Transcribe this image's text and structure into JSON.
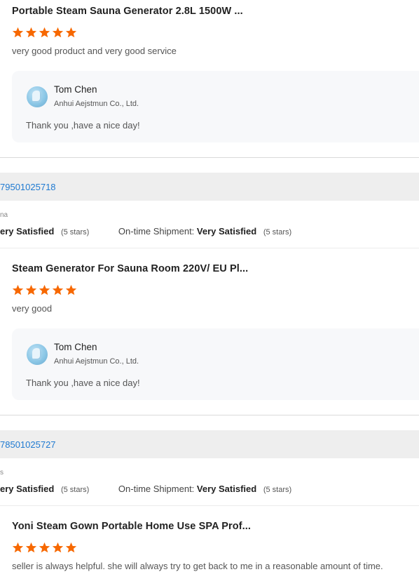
{
  "colors": {
    "star": "#f76800",
    "order_link": "#1f7ad1"
  },
  "reviews": [
    {
      "product_title": "Portable Steam Sauna Generator 2.8L 1500W ...",
      "rating": 5,
      "text": "very good product and very good service",
      "reply": {
        "name": "Tom Chen",
        "company": "Anhui Aejstmun Co., Ltd.",
        "text": "Thank you ,have a nice day!"
      }
    },
    {
      "order_id": "79501025718",
      "country": "na",
      "supplier_service_value": "ery Satisfied",
      "supplier_service_stars": "(5 stars)",
      "shipment_label": "On-time Shipment:",
      "shipment_value": "Very Satisfied",
      "shipment_stars": "(5 stars)",
      "product_title": "Steam Generator For Sauna Room 220V/ EU Pl...",
      "rating": 5,
      "text": "very good",
      "reply": {
        "name": "Tom Chen",
        "company": "Anhui Aejstmun Co., Ltd.",
        "text": "Thank you ,have a nice day!"
      }
    },
    {
      "order_id": "78501025727",
      "country": "s",
      "supplier_service_value": "ery Satisfied",
      "supplier_service_stars": "(5 stars)",
      "shipment_label": "On-time Shipment:",
      "shipment_value": "Very Satisfied",
      "shipment_stars": "(5 stars)",
      "product_title": "Yoni Steam Gown Portable Home Use SPA Prof...",
      "rating": 5,
      "text": "seller is always helpful. she will always try to get back to me in a reasonable amount of time."
    }
  ]
}
